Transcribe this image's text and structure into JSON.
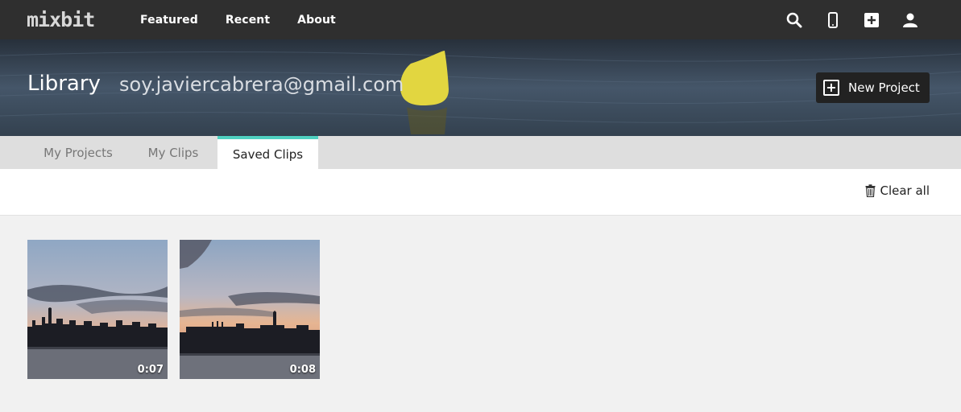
{
  "topbar": {
    "logo_text": "mixbit",
    "nav": [
      {
        "label": "Featured"
      },
      {
        "label": "Recent"
      },
      {
        "label": "About"
      }
    ],
    "icons": [
      "search-icon",
      "phone-icon",
      "add-square-icon",
      "user-icon"
    ]
  },
  "header": {
    "title": "Library",
    "email": "soy.javiercabrera@gmail.com",
    "new_project_label": "New Project"
  },
  "tabs": [
    {
      "label": "My Projects",
      "active": false
    },
    {
      "label": "My Clips",
      "active": false
    },
    {
      "label": "Saved Clips",
      "active": true
    }
  ],
  "toolbar": {
    "clear_all_label": "Clear all"
  },
  "clips": [
    {
      "duration": "0:07"
    },
    {
      "duration": "0:08"
    }
  ],
  "colors": {
    "accent": "#4fd1c1",
    "topbar": "#2f2f2f",
    "button": "#222222"
  }
}
